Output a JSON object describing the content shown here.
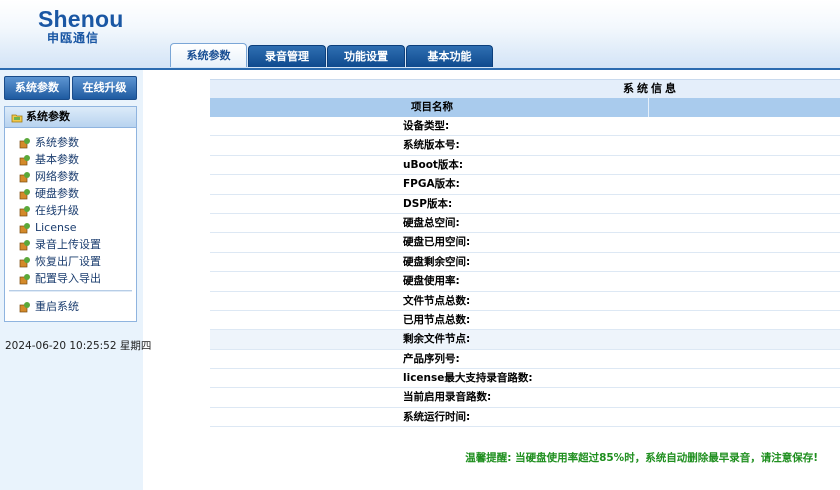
{
  "header": {
    "logo_main": "Shenou",
    "logo_sub": "申瓯通信",
    "tabs": [
      {
        "label": "系统参数",
        "active": true
      },
      {
        "label": "录音管理",
        "active": false
      },
      {
        "label": "功能设置",
        "active": false
      },
      {
        "label": "基本功能",
        "active": false
      }
    ]
  },
  "sidebar": {
    "top_buttons": [
      "系统参数",
      "在线升级"
    ],
    "menu_title": "系统参数",
    "menu_items": [
      "系统参数",
      "基本参数",
      "网络参数",
      "硬盘参数",
      "在线升级",
      "License",
      "录音上传设置",
      "恢复出厂设置",
      "配置导入导出"
    ],
    "reboot_label": "重启系统",
    "datetime": "2024-06-20 10:25:52 星期四"
  },
  "info": {
    "title": "系统信息",
    "column_header": "项目名称",
    "rows": [
      "设备类型:",
      "系统版本号:",
      "uBoot版本:",
      "FPGA版本:",
      "DSP版本:",
      "硬盘总空间:",
      "硬盘已用空间:",
      "硬盘剩余空间:",
      "硬盘使用率:",
      "文件节点总数:",
      "已用节点总数:",
      "剩余文件节点:",
      "产品序列号:",
      "license最大支持录音路数:",
      "当前启用录音路数:",
      "系统运行时间:"
    ]
  },
  "warning": "温馨提醒: 当硬盘使用率超过85%时，系统自动删除最早录音，请注意保存!",
  "colors": {
    "brand_blue": "#1a57a4",
    "tab_blue": "#1e5aa0",
    "warning_green": "#1f8f1f"
  }
}
